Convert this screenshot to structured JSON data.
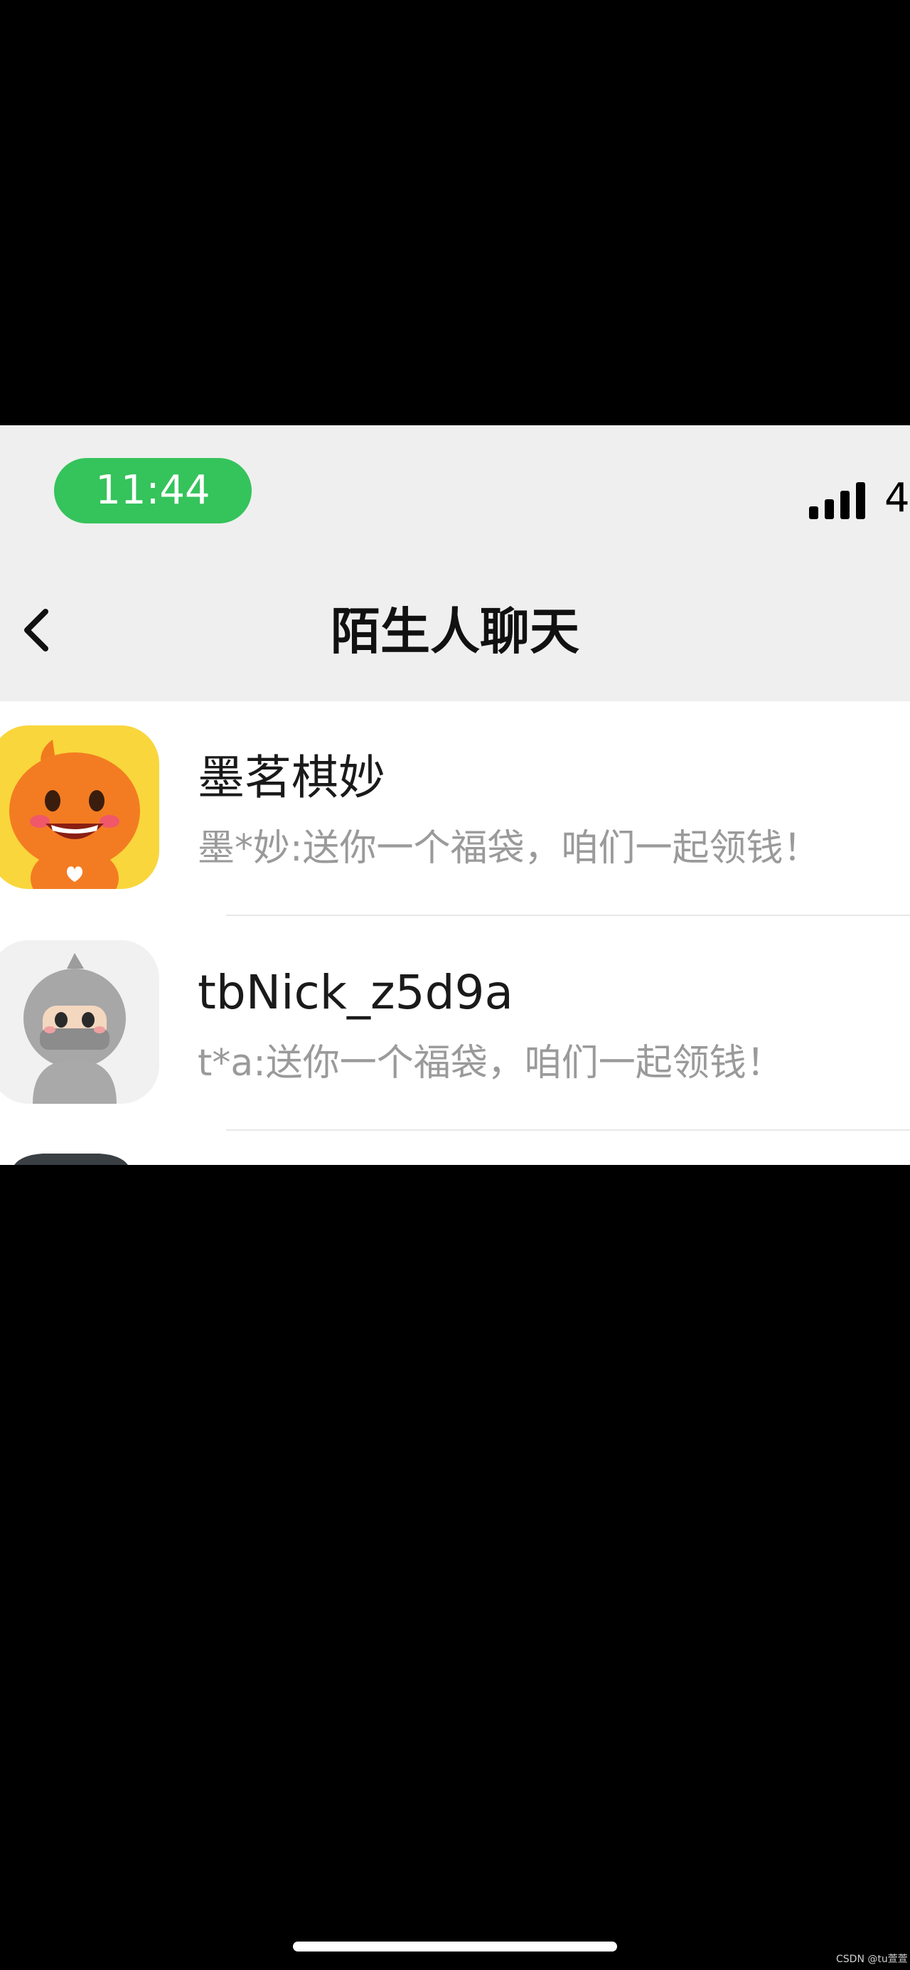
{
  "status_bar": {
    "time": "11:44",
    "battery_text": "4",
    "signal_icon": "cellular-signal-icon"
  },
  "nav": {
    "title": "陌生人聊天",
    "back_icon": "chevron-left-icon"
  },
  "chats": [
    {
      "name": "墨茗棋妙",
      "preview": "墨*妙:送你一个福袋，咱们一起领钱！",
      "avatar_icon": "orange-mascot-avatar"
    },
    {
      "name": "tbNick_z5d9a",
      "preview": "t*a:送你一个福袋，咱们一起领钱！",
      "avatar_icon": "gray-hooded-mascot-avatar"
    }
  ],
  "watermark": "CSDN @tu萱萱",
  "colors": {
    "time_pill": "#35c35b",
    "header_bg": "#efefef",
    "preview_text": "#9a9a9a"
  }
}
